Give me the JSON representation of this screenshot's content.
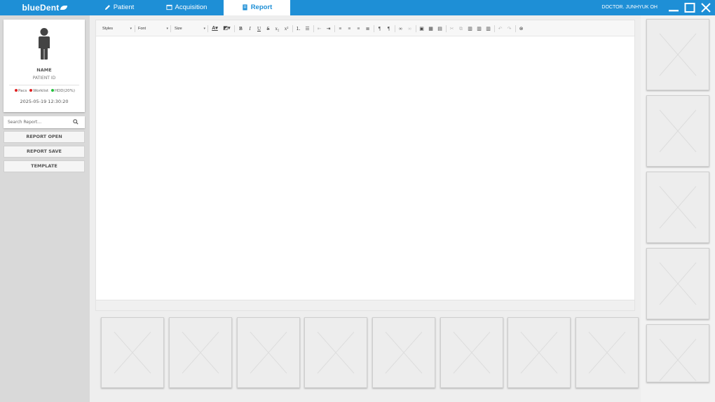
{
  "app": {
    "logo": "blueDent"
  },
  "tabs": [
    {
      "label": "Patient",
      "icon": "pencil-icon",
      "active": false
    },
    {
      "label": "Acquisition",
      "icon": "monitor-icon",
      "active": false
    },
    {
      "label": "Report",
      "icon": "document-icon",
      "active": true
    }
  ],
  "header": {
    "doctor": "DOCTOR. JUNHYUK OH"
  },
  "patient": {
    "name": "NAME",
    "id": "PATIENT ID",
    "status": [
      {
        "label": "Pacs",
        "color": "#e02020"
      },
      {
        "label": "Worklist",
        "color": "#e02020"
      },
      {
        "label": "HDD(20%)",
        "color": "#22c03a"
      }
    ],
    "timestamp": "2025-05-19 12:30:20"
  },
  "search": {
    "placeholder": "Search Report..."
  },
  "buttons": {
    "open": "REPORT OPEN",
    "save": "REPORT SAVE",
    "template": "TEMPLATE"
  },
  "toolbar": {
    "styles": "Styles",
    "font": "Font",
    "size": "Size"
  },
  "colors": {
    "brand": "#1e8fd6",
    "panel": "#d9d9d9",
    "thumb": "#ededed"
  },
  "thumbnails": {
    "bottom_count": 8,
    "right_count": 5
  }
}
